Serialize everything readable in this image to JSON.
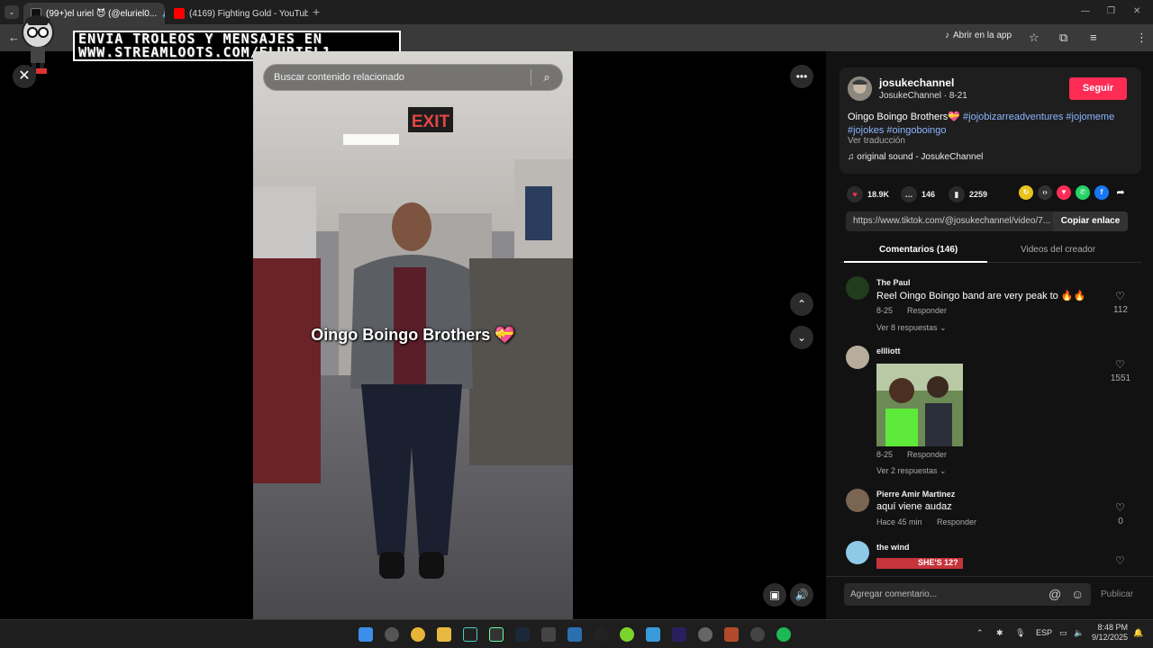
{
  "browser": {
    "tabs": [
      {
        "label": "(99+)el uriel 😈 (@eluriel0...",
        "active": true
      },
      {
        "label": "(4169) Fighting Gold - YouTube",
        "active": false
      }
    ],
    "app_button": "Abrir en la app"
  },
  "overlay": {
    "line1": "ENVIA TROLEOS Y MENSAJES EN",
    "line2": "WWW.STREAMLOOTS.COM/ELURIEL1"
  },
  "video": {
    "search_placeholder": "Buscar contenido relacionado",
    "caption": "Oingo Boingo Brothers 💝"
  },
  "channel": {
    "name": "josukechannel",
    "subline": "JosukeChannel · 8-21",
    "follow_label": "Seguir",
    "description_prefix": "Oingo Boingo Brothers💝 ",
    "hashtags": [
      "#jojobizarreadventures",
      "#jojomeme",
      "#jojokes",
      "#oingoboingo"
    ],
    "translate_label": "Ver traducción",
    "sound": "original sound - JosukeChannel"
  },
  "stats": {
    "likes": "18.9K",
    "comments": "146",
    "saves": "2259"
  },
  "link": {
    "url": "https://www.tiktok.com/@josukechannel/video/7...",
    "copy_label": "Copiar enlace"
  },
  "tabs": {
    "comments": "Comentarios (146)",
    "creator_videos": "Videos del creador"
  },
  "comments": [
    {
      "user": "The Paul",
      "text": "Reel Oingo Boingo band are very peak to 🔥🔥",
      "date": "8-25",
      "reply": "Responder",
      "more": "Ver 8 respuestas ⌄",
      "likes": "112"
    },
    {
      "user": "ellliott",
      "text": "",
      "date": "8-25",
      "reply": "Responder",
      "more": "Ver 2 respuestas ⌄",
      "likes": "1551"
    },
    {
      "user": "Pierre Amir Martinez",
      "text": "aquí viene audaz",
      "date": "Hace 45 min",
      "reply": "Responder",
      "more": "",
      "likes": "0"
    },
    {
      "user": "the wind",
      "text": "",
      "date": "",
      "reply": "",
      "more": "",
      "likes": ""
    }
  ],
  "comment_sticker_text": "SHE'S 12?",
  "comment_input": {
    "placeholder": "Agregar comentario...",
    "publish": "Publicar"
  },
  "taskbar": {
    "lang": "ESP",
    "time": "8:48 PM",
    "date": "9/12/2025"
  }
}
